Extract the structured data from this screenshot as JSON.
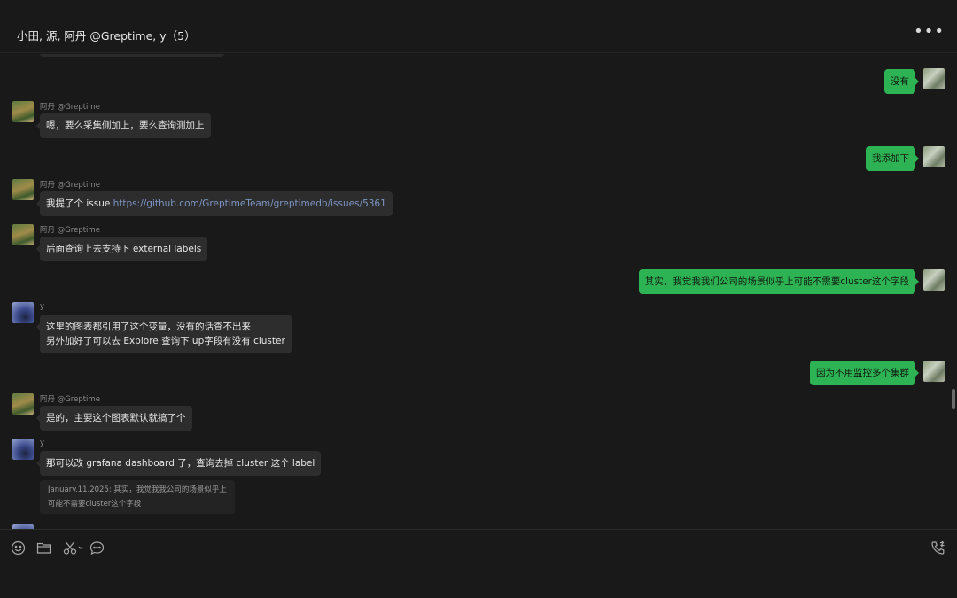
{
  "header": {
    "title": "小田, 源, 阿丹 @Greptime, y（5）",
    "more_icon": "more-horizontal-icon"
  },
  "messages": [
    {
      "from": "me",
      "text": "没有"
    },
    {
      "from": "阿丹 @Greptime",
      "text": "嗯，要么采集侧加上，要么查询测加上"
    },
    {
      "from": "me",
      "text": "我添加下"
    },
    {
      "from": "阿丹 @Greptime",
      "text_prefix": "我提了个 issue ",
      "link": "https://github.com/GreptimeTeam/greptimedb/issues/5361"
    },
    {
      "from": "阿丹 @Greptime",
      "text": "后面查询上去支持下 external labels"
    },
    {
      "from": "me",
      "text": "其实，我觉我我们公司的场景似乎上可能不需要cluster这个字段"
    },
    {
      "from": "y",
      "line1": "这里的图表都引用了这个变量，没有的话查不出来",
      "line2": "另外加好了可以去 Explore 查询下 up字段有没有 cluster"
    },
    {
      "from": "me",
      "text": "因为不用监控多个集群"
    },
    {
      "from": "阿丹 @Greptime",
      "text": "是的，主要这个图表默认就搞了个"
    },
    {
      "from": "y",
      "text": "那可以改 grafana dashboard 了，查询去掉 cluster 这个 label"
    }
  ],
  "quote": {
    "line1": "January.11.2025: 其实，我觉我我公司的场景似乎上",
    "line2": "可能不需要cluster这个字段"
  },
  "senders": {
    "adan": "阿丹 @Greptime",
    "y": "y"
  },
  "toolbar": {
    "icons": [
      "emoji-icon",
      "folder-icon",
      "scissors-icon",
      "chat-bubble-icon",
      "phone-icon"
    ]
  },
  "colors": {
    "background": "#191919",
    "incoming_bubble": "#2d2d2d",
    "outgoing_bubble": "#2eb354",
    "link": "#7d95c4"
  }
}
